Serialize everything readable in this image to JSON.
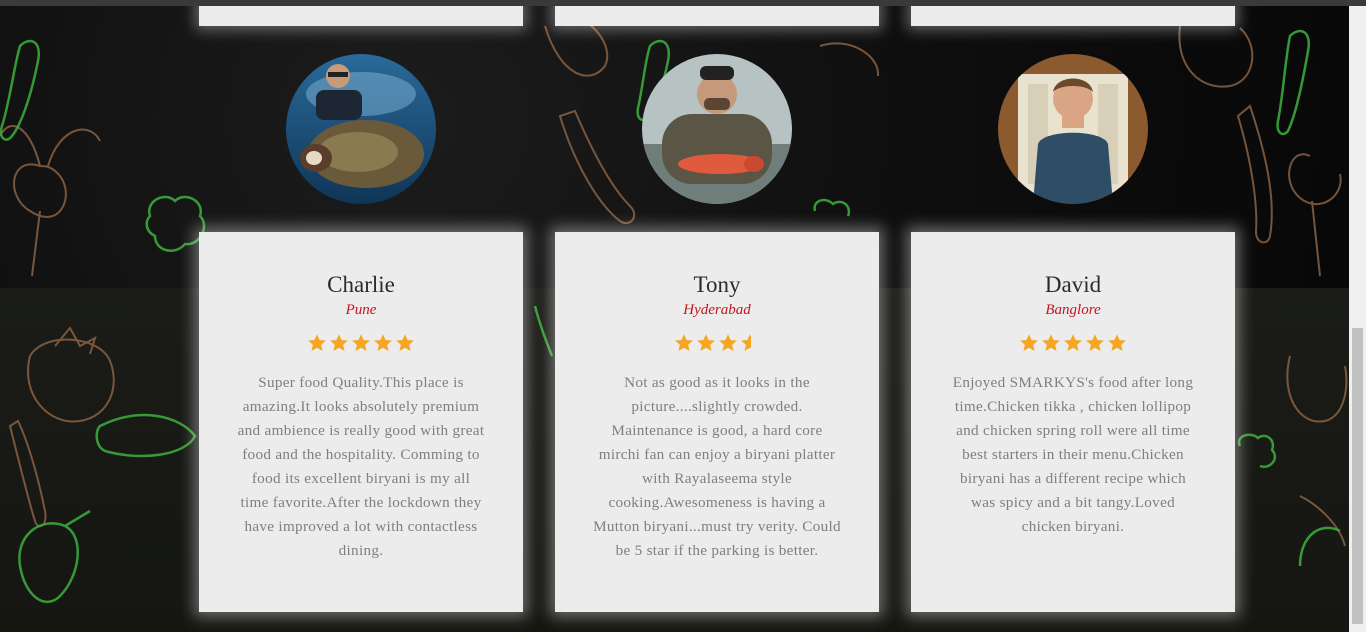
{
  "colors": {
    "star": "#f5a623",
    "city": "#c3161c",
    "card_bg": "#ececec",
    "review_text": "#7f7f7f"
  },
  "reviews": [
    {
      "name": "Charlie",
      "city": "Pune",
      "rating": 5,
      "text": "Super food Quality.This place is amazing.It looks absolutely premium and ambience is really good with great food and the hospitality. Comming to food its excellent biryani is my all time favorite.After the lockdown they have improved a lot with contactless dining."
    },
    {
      "name": "Tony",
      "city": "Hyderabad",
      "rating": 3.5,
      "text": "Not as good as it looks in the picture....slightly crowded. Maintenance is good, a hard core mirchi fan can enjoy a biryani platter with Rayalaseema style cooking.Awesomeness is having a Mutton biryani...must try verity. Could be 5 star if the parking is better."
    },
    {
      "name": "David",
      "city": "Banglore",
      "rating": 5,
      "text": "Enjoyed SMARKYS's food after long time.Chicken tikka , chicken lollipop and chicken spring roll were all time best starters in their menu.Chicken biryani has a different recipe which was spicy and a bit tangy.Loved chicken biryani."
    }
  ]
}
